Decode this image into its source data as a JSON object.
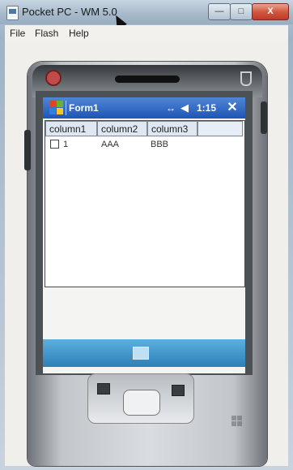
{
  "window": {
    "title": "Pocket PC - WM 5.0",
    "controls": {
      "minimize": "—",
      "maximize": "□",
      "close": "X"
    }
  },
  "menubar": {
    "items": [
      "File",
      "Flash",
      "Help"
    ]
  },
  "device": {
    "title": "Form1",
    "time": "1:15",
    "ok_label": "✕",
    "icons": {
      "connectivity": "↔",
      "volume": "◀"
    }
  },
  "grid": {
    "columns": [
      "column1",
      "column2",
      "column3"
    ],
    "rows": [
      {
        "col1": "1",
        "col2": "AAA",
        "col3": "BBB",
        "checked": false
      }
    ]
  },
  "colors": {
    "pda_titlebar": "#1f55b4",
    "sip_bar": "#2d7fb8",
    "close_button": "#c0392b"
  }
}
